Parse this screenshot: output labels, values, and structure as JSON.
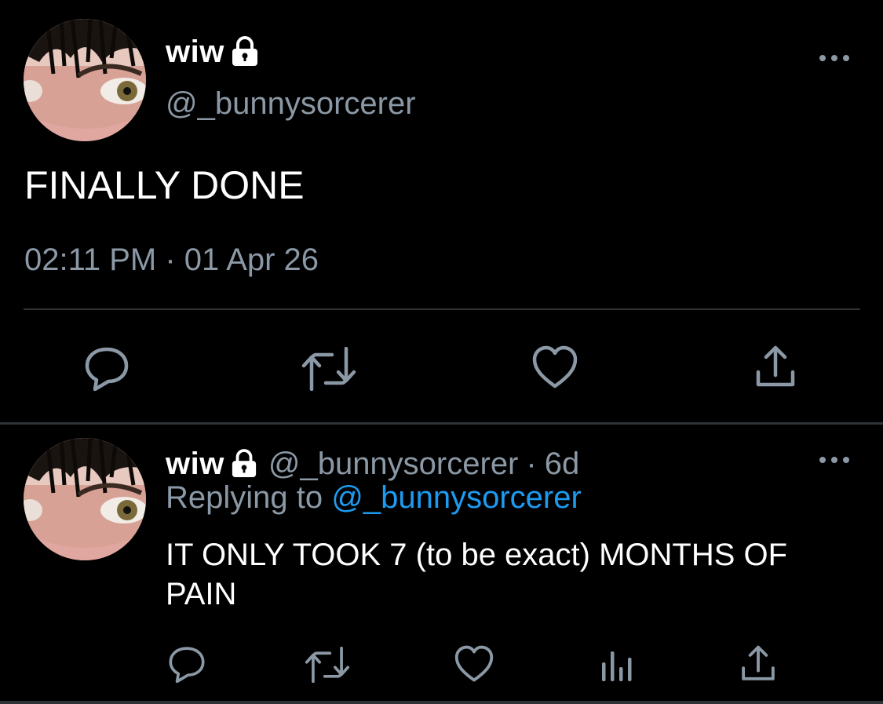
{
  "main_tweet": {
    "display_name": "wiw",
    "handle": "@_bunnysorcerer",
    "text": "FINALLY DONE",
    "timestamp": "02:11 PM · 01 Apr 26",
    "actions": [
      "reply-icon",
      "retweet-icon",
      "like-icon",
      "share-icon"
    ]
  },
  "reply_tweet": {
    "display_name": "wiw",
    "handle": "@_bunnysorcerer",
    "separator": "·",
    "age": "6d",
    "replying_label": "Replying to",
    "replying_to": "@_bunnysorcerer",
    "text": "IT ONLY TOOK 7 (to be exact) MONTHS OF PAIN",
    "actions": [
      "reply-icon",
      "retweet-icon",
      "like-icon",
      "stats-icon",
      "share-icon"
    ]
  },
  "colors": {
    "background": "#000000",
    "primary_text": "#ffffff",
    "secondary_text": "#8b98a5",
    "mention": "#1d9bf0",
    "divider": "#2f3336"
  }
}
